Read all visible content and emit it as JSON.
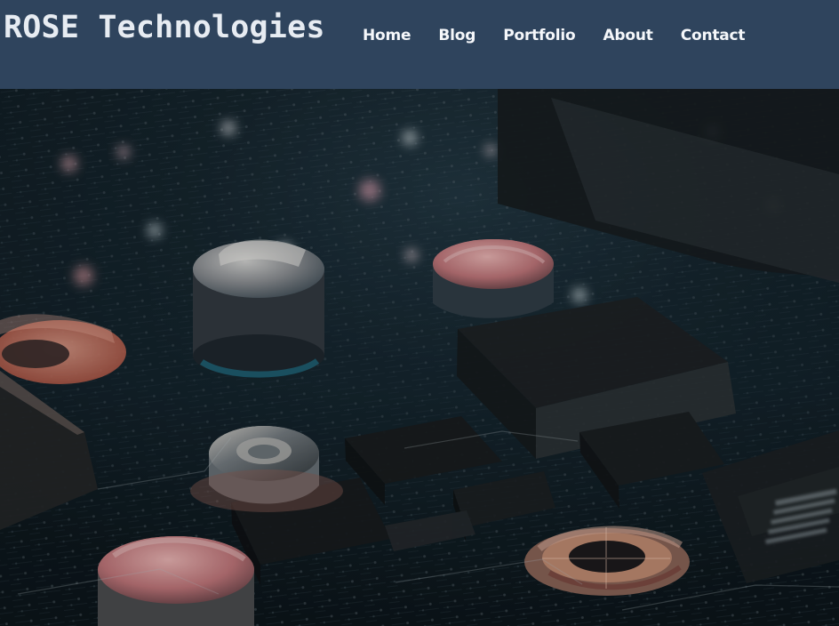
{
  "header": {
    "brand": "ROSE Technologies",
    "nav": [
      {
        "label": "Home"
      },
      {
        "label": "Blog"
      },
      {
        "label": "Portfolio"
      },
      {
        "label": "About"
      },
      {
        "label": "Contact"
      }
    ]
  },
  "hero": {
    "image_name": "circuit-board-hero-image"
  },
  "colors": {
    "header_background": "#2f445d",
    "header_text": "#f5f7fa"
  }
}
